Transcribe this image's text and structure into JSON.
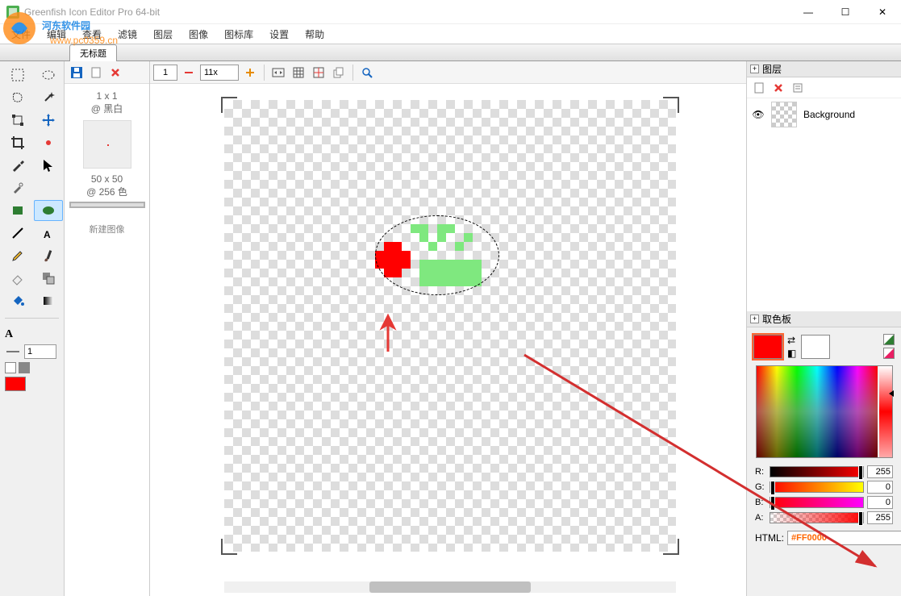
{
  "window": {
    "title": "Greenfish Icon Editor Pro 64-bit",
    "controls": {
      "min": "—",
      "max": "☐",
      "close": "✕"
    }
  },
  "menu": [
    "文件",
    "编辑",
    "查看",
    "滤镜",
    "图层",
    "图像",
    "图标库",
    "设置",
    "帮助"
  ],
  "watermark": {
    "line1": "河东软件园",
    "line2": "www.pc0359.cn"
  },
  "tab": {
    "label": "无标题"
  },
  "toolbox_options": {
    "line_width": "1",
    "current_color": "#FF0000"
  },
  "thumbnails": {
    "info_size": "1 x 1",
    "info_mode": "@ 黑白",
    "selected_size": "50 x 50",
    "selected_mode": "@ 256 色",
    "caption": "新建图像"
  },
  "canvas_toolbar": {
    "page": "1",
    "zoom": "11x"
  },
  "layers": {
    "title": "图层",
    "items": [
      {
        "name": "Background",
        "visible": true
      }
    ]
  },
  "palette": {
    "title": "取色板",
    "fg": "#FF0000",
    "bg": "#FFFFFF",
    "r": "255",
    "g": "0",
    "b": "0",
    "a": "255",
    "html_label": "HTML:",
    "html": "#FF0000",
    "r_label": "R:",
    "g_label": "G:",
    "b_label": "B:",
    "a_label": "A:"
  }
}
